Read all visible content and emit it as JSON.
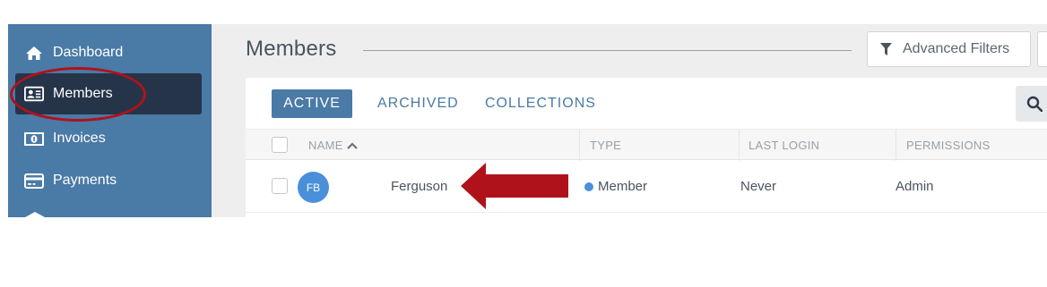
{
  "sidebar": {
    "items": [
      {
        "label": "Dashboard",
        "icon": "home-icon"
      },
      {
        "label": "Members",
        "icon": "id-card-icon",
        "active": true
      },
      {
        "label": "Invoices",
        "icon": "money-icon"
      },
      {
        "label": "Payments",
        "icon": "credit-card-icon"
      }
    ]
  },
  "header": {
    "title": "Members",
    "filter_button": {
      "label": "Advanced Filters",
      "icon": "filter-icon"
    }
  },
  "tabs": [
    {
      "label": "ACTIVE",
      "active": true
    },
    {
      "label": "ARCHIVED"
    },
    {
      "label": "COLLECTIONS"
    }
  ],
  "table": {
    "columns": [
      "NAME",
      "TYPE",
      "LAST LOGIN",
      "PERMISSIONS"
    ],
    "rows": [
      {
        "initials": "FB",
        "name": "Ferguson",
        "type": "Member",
        "last_login": "Never",
        "permissions": "Admin"
      }
    ]
  },
  "colors": {
    "sidebar_bg": "#4a7aa6",
    "sidebar_active_bg": "#26344a",
    "accent": "#4a7aa6",
    "avatar_bg": "#4a90d9",
    "annotation": "#b0121b"
  }
}
